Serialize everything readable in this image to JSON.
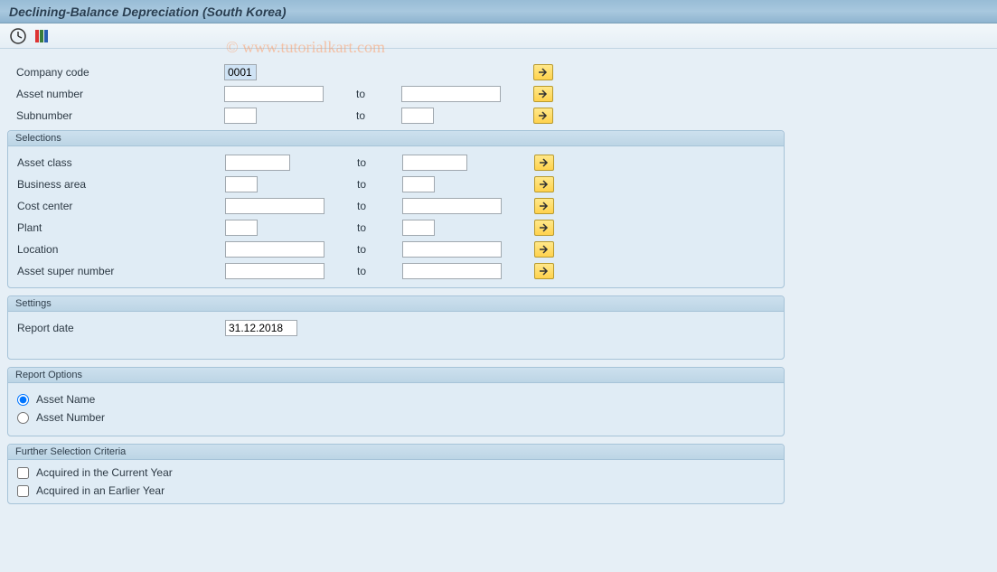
{
  "title": "Declining-Balance Depreciation (South Korea)",
  "watermark": "© www.tutorialkart.com",
  "top": {
    "company_code": {
      "label": "Company code",
      "value": "0001"
    },
    "asset_number": {
      "label": "Asset number",
      "value": "",
      "to_label": "to",
      "to_value": ""
    },
    "subnumber": {
      "label": "Subnumber",
      "value": "",
      "to_label": "to",
      "to_value": ""
    }
  },
  "selections": {
    "header": "Selections",
    "rows": [
      {
        "label": "Asset class",
        "from": "",
        "to_label": "to",
        "to": "",
        "size": "mid"
      },
      {
        "label": "Business area",
        "from": "",
        "to_label": "to",
        "to": "",
        "size": "small"
      },
      {
        "label": "Cost center",
        "from": "",
        "to_label": "to",
        "to": "",
        "size": "med"
      },
      {
        "label": "Plant",
        "from": "",
        "to_label": "to",
        "to": "",
        "size": "small"
      },
      {
        "label": "Location",
        "from": "",
        "to_label": "to",
        "to": "",
        "size": "med"
      },
      {
        "label": "Asset super number",
        "from": "",
        "to_label": "to",
        "to": "",
        "size": "med"
      }
    ]
  },
  "settings": {
    "header": "Settings",
    "report_date": {
      "label": "Report date",
      "value": "31.12.2018"
    }
  },
  "report_options": {
    "header": "Report Options",
    "opt1": "Asset Name",
    "opt2": "Asset Number",
    "selected": "opt1"
  },
  "further": {
    "header": "Further Selection Criteria",
    "chk1": "Acquired in the Current Year",
    "chk2": "Acquired in an Earlier Year"
  }
}
